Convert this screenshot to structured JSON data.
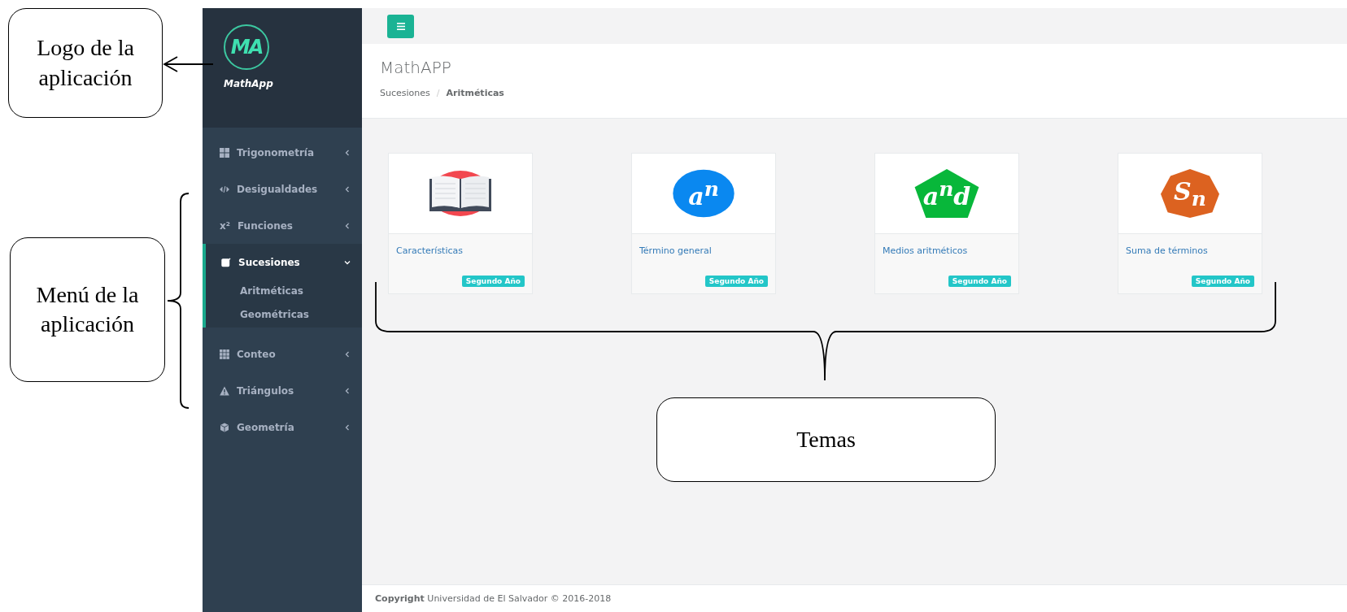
{
  "callouts": [
    {
      "text": "Logo de la aplicación"
    },
    {
      "text": "Menú de la aplicación"
    },
    {
      "text": "Temas"
    }
  ],
  "sidebar": {
    "logo_text": "MA",
    "app_name": "MathApp",
    "items": [
      {
        "label": "Trigonometría",
        "expanded": false,
        "selected": false
      },
      {
        "label": "Desigualdades",
        "expanded": false,
        "selected": false
      },
      {
        "label": "Funciones",
        "glyph": "x²",
        "expanded": false,
        "selected": false
      },
      {
        "label": "Sucesiones",
        "expanded": true,
        "selected": true,
        "children": [
          {
            "label": "Aritméticas"
          },
          {
            "label": "Geométricas"
          }
        ]
      },
      {
        "label": "Conteo",
        "expanded": false,
        "selected": false
      },
      {
        "label": "Triángulos",
        "expanded": false,
        "selected": false
      },
      {
        "label": "Geometría",
        "expanded": false,
        "selected": false
      }
    ]
  },
  "header": {
    "title": "MathAPP",
    "breadcrumb": [
      "Sucesiones",
      "/",
      "Aritméticas"
    ]
  },
  "cards": [
    {
      "kind": "book",
      "title": "Características",
      "badge": "Segundo Año"
    },
    {
      "kind": "circle",
      "icon_text": "a$^{n}$",
      "title": "Término general",
      "badge": "Segundo Año"
    },
    {
      "kind": "pentagon",
      "icon_text": "a$^{n}$d",
      "title": "Medios aritméticos",
      "badge": "Segundo Año"
    },
    {
      "kind": "heptagon",
      "icon_text": "S$_{n}$",
      "title": "Suma de términos",
      "badge": "Segundo Año"
    }
  ],
  "footer": "**Copyright** Universidad de El Salvador © 2016-2018"
}
